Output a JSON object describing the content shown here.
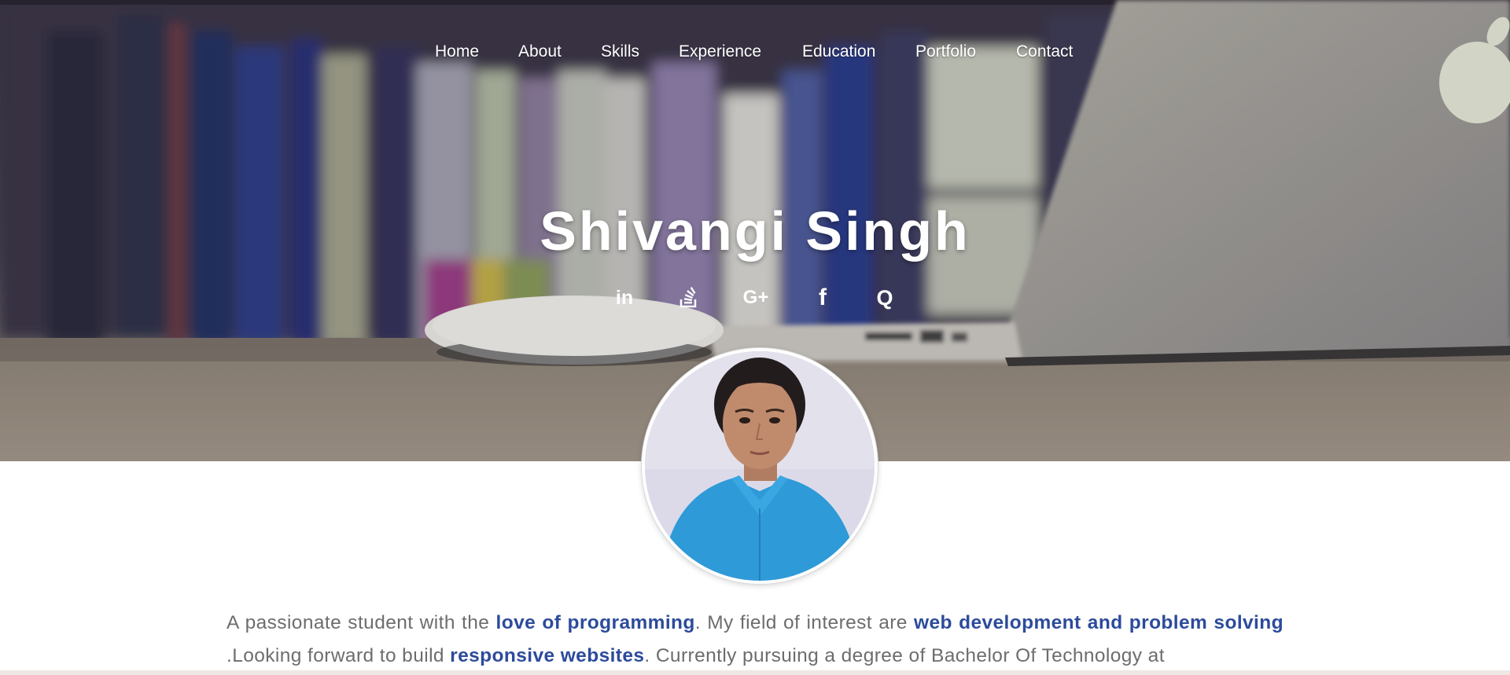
{
  "nav": {
    "items": [
      {
        "label": "Home"
      },
      {
        "label": "About"
      },
      {
        "label": "Skills"
      },
      {
        "label": "Experience"
      },
      {
        "label": "Education"
      },
      {
        "label": "Portfolio"
      },
      {
        "label": "Contact"
      }
    ]
  },
  "hero": {
    "name": "Shivangi Singh"
  },
  "social": {
    "icons": [
      "linkedin-icon",
      "stack-overflow-icon",
      "google-plus-icon",
      "facebook-icon",
      "quora-icon"
    ],
    "linkedin_glyph": "in",
    "google_glyph": "G+",
    "facebook_glyph": "f",
    "quora_glyph": "Q"
  },
  "about": {
    "t1": "A passionate student with the ",
    "h1": "love of programming",
    "t2": ". My field of interest are ",
    "h2": "web development and problem solving",
    "t3": " .Looking forward to build ",
    "h3": "responsive websites",
    "t4": ". Currently pursuing a degree of Bachelor Of Technology at"
  },
  "colors": {
    "nav_text": "#ffffff",
    "name_text": "#ffffff",
    "body_text": "#6d6d6d",
    "highlight": "#2c4b9b",
    "avatar_shirt": "#2e9ad8"
  }
}
